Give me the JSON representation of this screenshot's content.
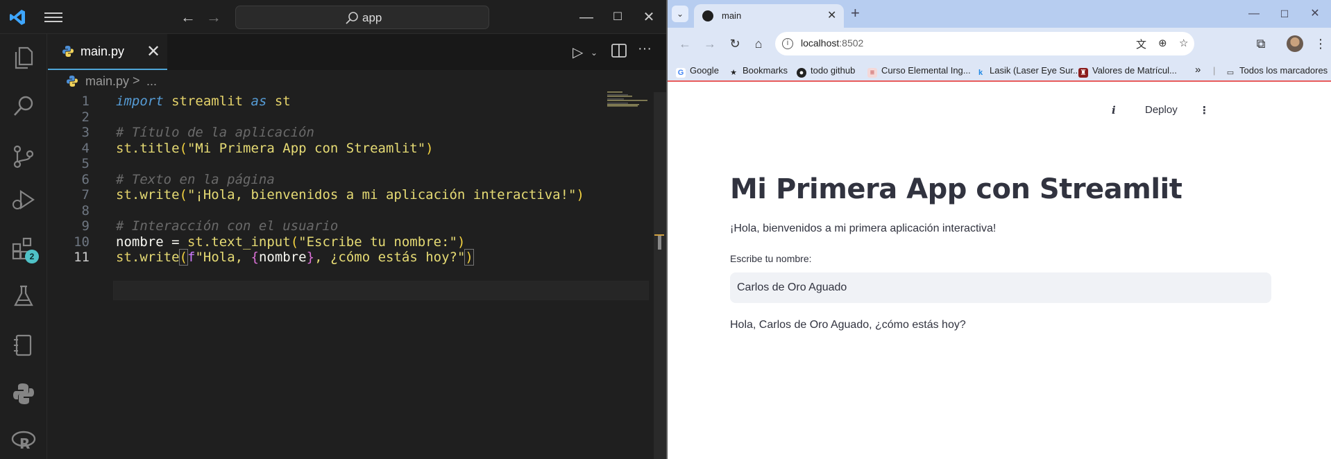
{
  "vscode": {
    "search_text": "app",
    "tab_filename": "main.py",
    "breadcrumb_file": "main.py",
    "breadcrumb_sep": ">",
    "breadcrumb_more": "...",
    "extensions_badge": "2",
    "lines": [
      {
        "n": "1"
      },
      {
        "n": "2"
      },
      {
        "n": "3"
      },
      {
        "n": "4"
      },
      {
        "n": "5"
      },
      {
        "n": "6"
      },
      {
        "n": "7"
      },
      {
        "n": "8"
      },
      {
        "n": "9"
      },
      {
        "n": "10"
      },
      {
        "n": "11"
      }
    ],
    "code": {
      "l1_import": "import",
      "l1_mod": "streamlit",
      "l1_as": "as",
      "l1_alias": "st",
      "l3_comment": "# Título de la aplicación",
      "l4_obj": "st",
      "l4_fn": ".title",
      "l4_str": "\"Mi Primera App con Streamlit\"",
      "l6_comment": "# Texto en la página",
      "l7_obj": "st",
      "l7_fn": ".write",
      "l7_str": "\"¡Hola, bienvenidos a mi aplicación interactiva!\"",
      "l9_comment": "# Interacción con el usuario",
      "l10_var": "nombre",
      "l10_eq": " = ",
      "l10_obj": "st",
      "l10_fn": ".text_input",
      "l10_str": "\"Escribe tu nombre:\"",
      "l11_obj": "st",
      "l11_fn": ".write",
      "l11_fpre": "f",
      "l11_str1": "\"Hola, ",
      "l11_var": "nombre",
      "l11_str2": ", ¿cómo estás hoy?\""
    }
  },
  "chrome": {
    "tab_title": "main",
    "url_host": "localhost",
    "url_port": ":8502",
    "bookmarks": [
      {
        "label": "Google",
        "icon": "google-icon"
      },
      {
        "label": "Bookmarks",
        "icon": "star-icon"
      },
      {
        "label": "todo github",
        "icon": "github-icon"
      },
      {
        "label": "Curso Elemental Ing...",
        "icon": "course-icon"
      },
      {
        "label": "Lasik (Laser Eye Sur...",
        "icon": "k-icon"
      },
      {
        "label": "Valores de Matrícul...",
        "icon": "crest-icon"
      }
    ],
    "bookmarks_overflow": "»",
    "all_bookmarks": "Todos los marcadores"
  },
  "streamlit": {
    "deploy_label": "Deploy",
    "title": "Mi Primera App con Streamlit",
    "welcome_text": "¡Hola, bienvenidos a mi primera aplicación interactiva!",
    "input_label": "Escribe tu nombre:",
    "input_value": "Carlos de Oro Aguado",
    "greeting": "Hola, Carlos de Oro Aguado, ¿cómo estás hoy?"
  },
  "colors": {
    "vscode_bg": "#1f1f1f",
    "accent_blue": "#4fa6d8",
    "chrome_frame": "#b7cdf0",
    "streamlit_text": "#31333f"
  }
}
